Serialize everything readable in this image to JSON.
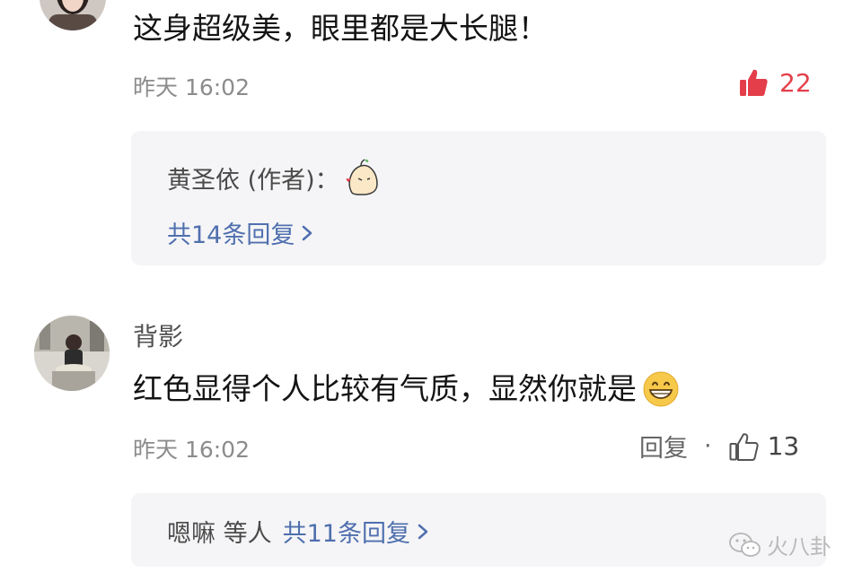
{
  "comments": [
    {
      "text": "这身超级美，眼里都是大长腿！",
      "time": "昨天 16:02",
      "likes": "22",
      "liked": true,
      "reply_preview": {
        "author": "黄圣依 (作者)：",
        "sticker_icon": "bean-sticker-icon",
        "more_label": "共14条回复"
      }
    },
    {
      "username": "背影",
      "text": "红色显得个人比较有气质，显然你就是",
      "emoji_icon": "grinning-face-icon",
      "time": "昨天 16:02",
      "reply_label": "回复",
      "separator": "·",
      "likes": "13",
      "liked": false,
      "reply_preview": {
        "names": "嗯嘛 等人",
        "more_label": "共11条回复"
      }
    }
  ],
  "watermark": {
    "text": "火八卦",
    "icon": "wechat-icon"
  },
  "colors": {
    "like_active": "#e33e4a",
    "link": "#4f6fae",
    "meta": "#8c8c8c",
    "reply_bg": "#f5f5f7"
  }
}
